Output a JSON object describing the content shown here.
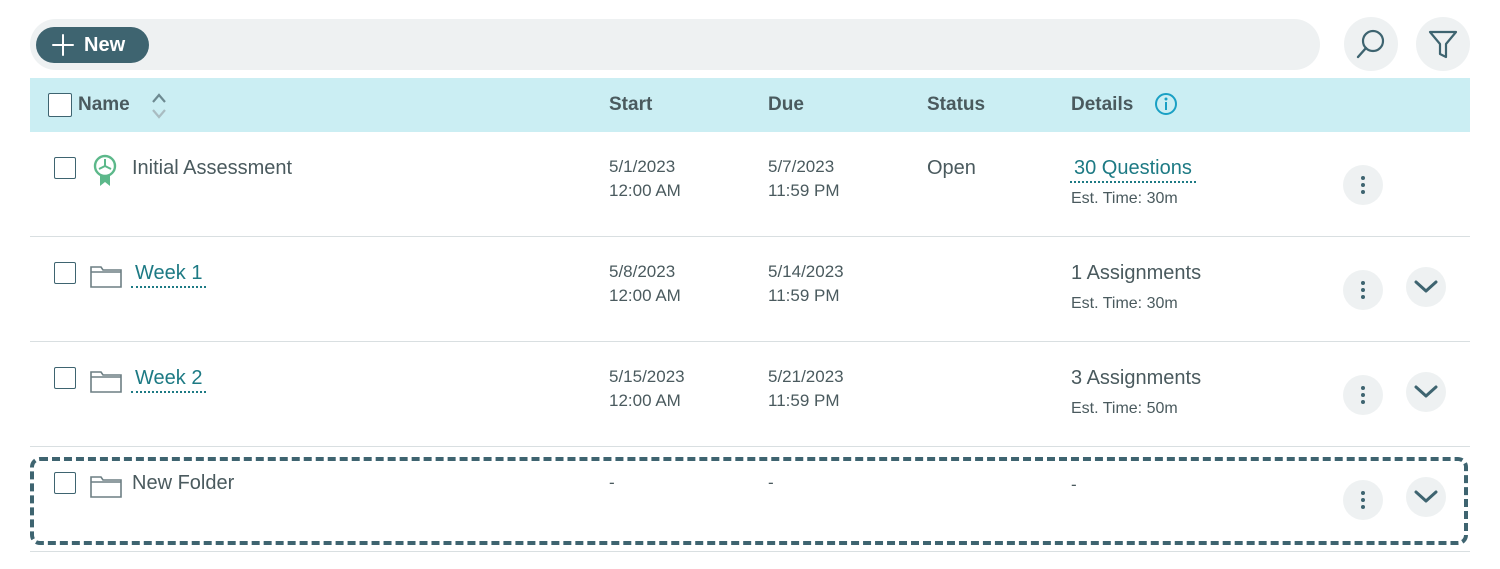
{
  "toolbar": {
    "new_label": "New",
    "icons": {
      "search": "search-icon",
      "filter": "filter-icon"
    }
  },
  "header": {
    "name": "Name",
    "start": "Start",
    "due": "Due",
    "status": "Status",
    "details": "Details"
  },
  "rows": [
    {
      "name": "Initial Assessment",
      "icon": "assessment-ribbon-icon",
      "is_link": false,
      "start_date": "5/1/2023",
      "start_time": "12:00 AM",
      "due_date": "5/7/2023",
      "due_time": "11:59 PM",
      "status": "Open",
      "details_main": "30 Questions",
      "details_sub": "Est. Time: 30m",
      "expandable": false
    },
    {
      "name": "Week 1",
      "icon": "folder-icon",
      "is_link": true,
      "start_date": "5/8/2023",
      "start_time": "12:00 AM",
      "due_date": "5/14/2023",
      "due_time": "11:59 PM",
      "status": "",
      "details_main": "1 Assignments",
      "details_sub": "Est. Time: 30m",
      "expandable": true
    },
    {
      "name": "Week 2",
      "icon": "folder-icon",
      "is_link": true,
      "start_date": "5/15/2023",
      "start_time": "12:00 AM",
      "due_date": "5/21/2023",
      "due_time": "11:59 PM",
      "status": "",
      "details_main": "3 Assignments",
      "details_sub": "Est. Time: 50m",
      "expandable": true
    },
    {
      "name": "New Folder",
      "icon": "folder-icon",
      "is_link": false,
      "start_dash": "-",
      "due_dash": "-",
      "details_dash": "-",
      "expandable": true,
      "selected": true
    }
  ],
  "colors": {
    "accent": "#3e6470",
    "header_bg": "#cbeef3",
    "link": "#1d7a84",
    "assessment_icon": "#5cb88a",
    "info_icon": "#1aa0c4"
  }
}
